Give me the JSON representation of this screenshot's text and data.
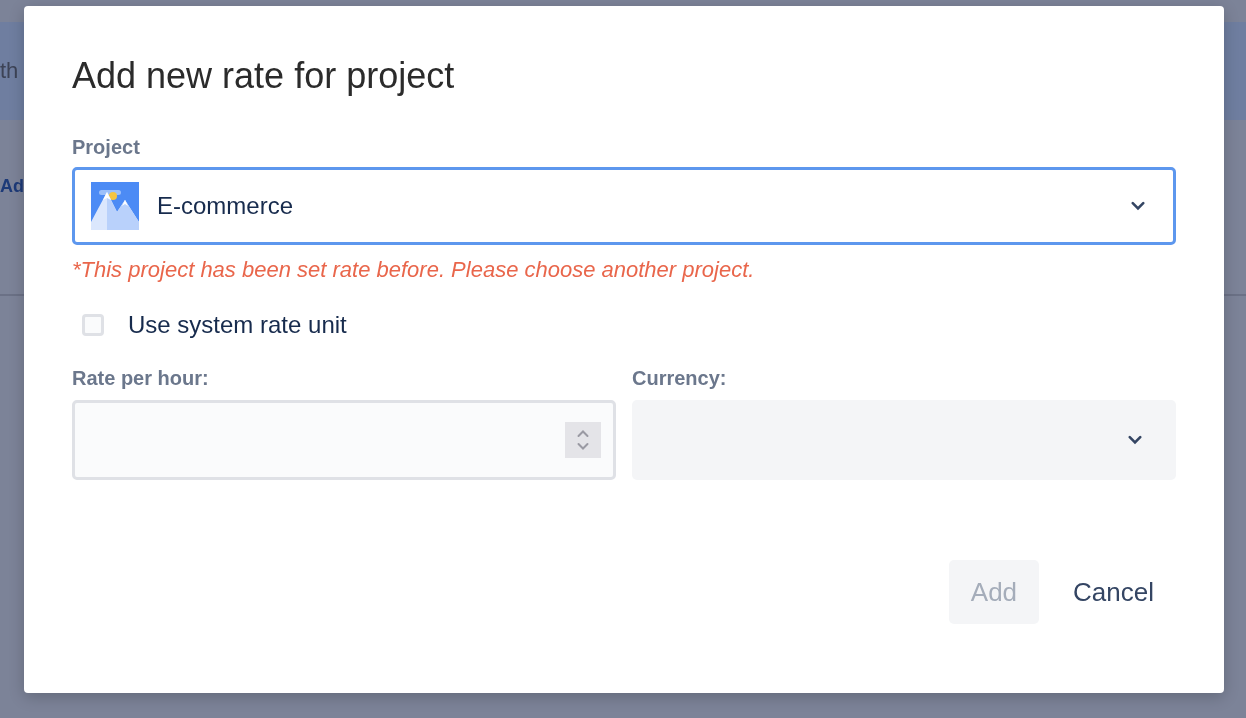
{
  "background_page": {
    "header_text": "th",
    "link_text": "Ad"
  },
  "dialog": {
    "title": "Add new rate for project",
    "project": {
      "label": "Project",
      "value": "E-commerce",
      "focused": true,
      "error": "*This project has been set rate before. Please choose another project."
    },
    "use_system_rate": {
      "label": "Use system rate unit",
      "checked": false
    },
    "rate_per_hour": {
      "label": "Rate per hour:"
    },
    "currency": {
      "label": "Currency:"
    },
    "buttons": [
      {
        "label": "Add",
        "kind": "primary",
        "disabled": true
      },
      {
        "label": "Cancel",
        "kind": "subtle",
        "disabled": false
      }
    ]
  }
}
